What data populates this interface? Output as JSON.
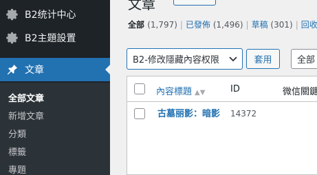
{
  "sidebar": {
    "items": [
      {
        "label": "B2统计中心",
        "icon": "gear-icon"
      },
      {
        "label": "B2主題設置",
        "icon": "gear-icon"
      },
      {
        "label": "文章",
        "icon": "pin-icon"
      }
    ],
    "submenu": [
      "全部文章",
      "新增文章",
      "分類",
      "標籤",
      "專題"
    ]
  },
  "header": {
    "title_fragment": "文章"
  },
  "filters": {
    "all_label": "全部",
    "all_count": "(1,797)",
    "published_label": "已發佈",
    "published_count": "(1,496)",
    "draft_label": "草稿",
    "draft_count": "(301)",
    "trash_label": "回收"
  },
  "bulk_actions": {
    "selected": "B2-修改隱藏內容权限",
    "apply_label": "套用",
    "date_filter": "全部"
  },
  "table": {
    "columns": [
      "內容標題",
      "ID",
      "微信關鍵"
    ],
    "rows": [
      {
        "title": "古墓丽影：暗影",
        "id": "14372"
      }
    ]
  },
  "colors": {
    "accent": "#2271b1",
    "sidebar_bg": "#1d2327",
    "submenu_bg": "#2c3338"
  }
}
